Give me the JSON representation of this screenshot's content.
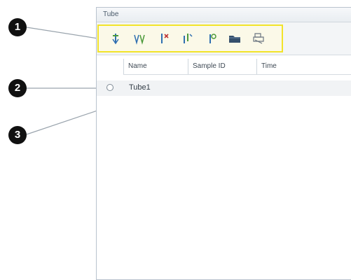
{
  "window": {
    "title": "Tube"
  },
  "toolbar": {
    "buttons": [
      {
        "icon": "new-tube-icon"
      },
      {
        "icon": "tube-rack-icon"
      },
      {
        "icon": "delete-tube-icon"
      },
      {
        "icon": "duplicate-tube-icon"
      },
      {
        "icon": "import-tube-icon"
      },
      {
        "icon": "open-folder-icon"
      },
      {
        "icon": "print-icon"
      }
    ],
    "highlight_color": "#f2e32a"
  },
  "table": {
    "columns": [
      "Name",
      "Sample ID",
      "Time"
    ],
    "rows": [
      {
        "name": "Tube1"
      }
    ]
  },
  "callouts": [
    {
      "label": "1"
    },
    {
      "label": "2"
    },
    {
      "label": "3"
    }
  ]
}
